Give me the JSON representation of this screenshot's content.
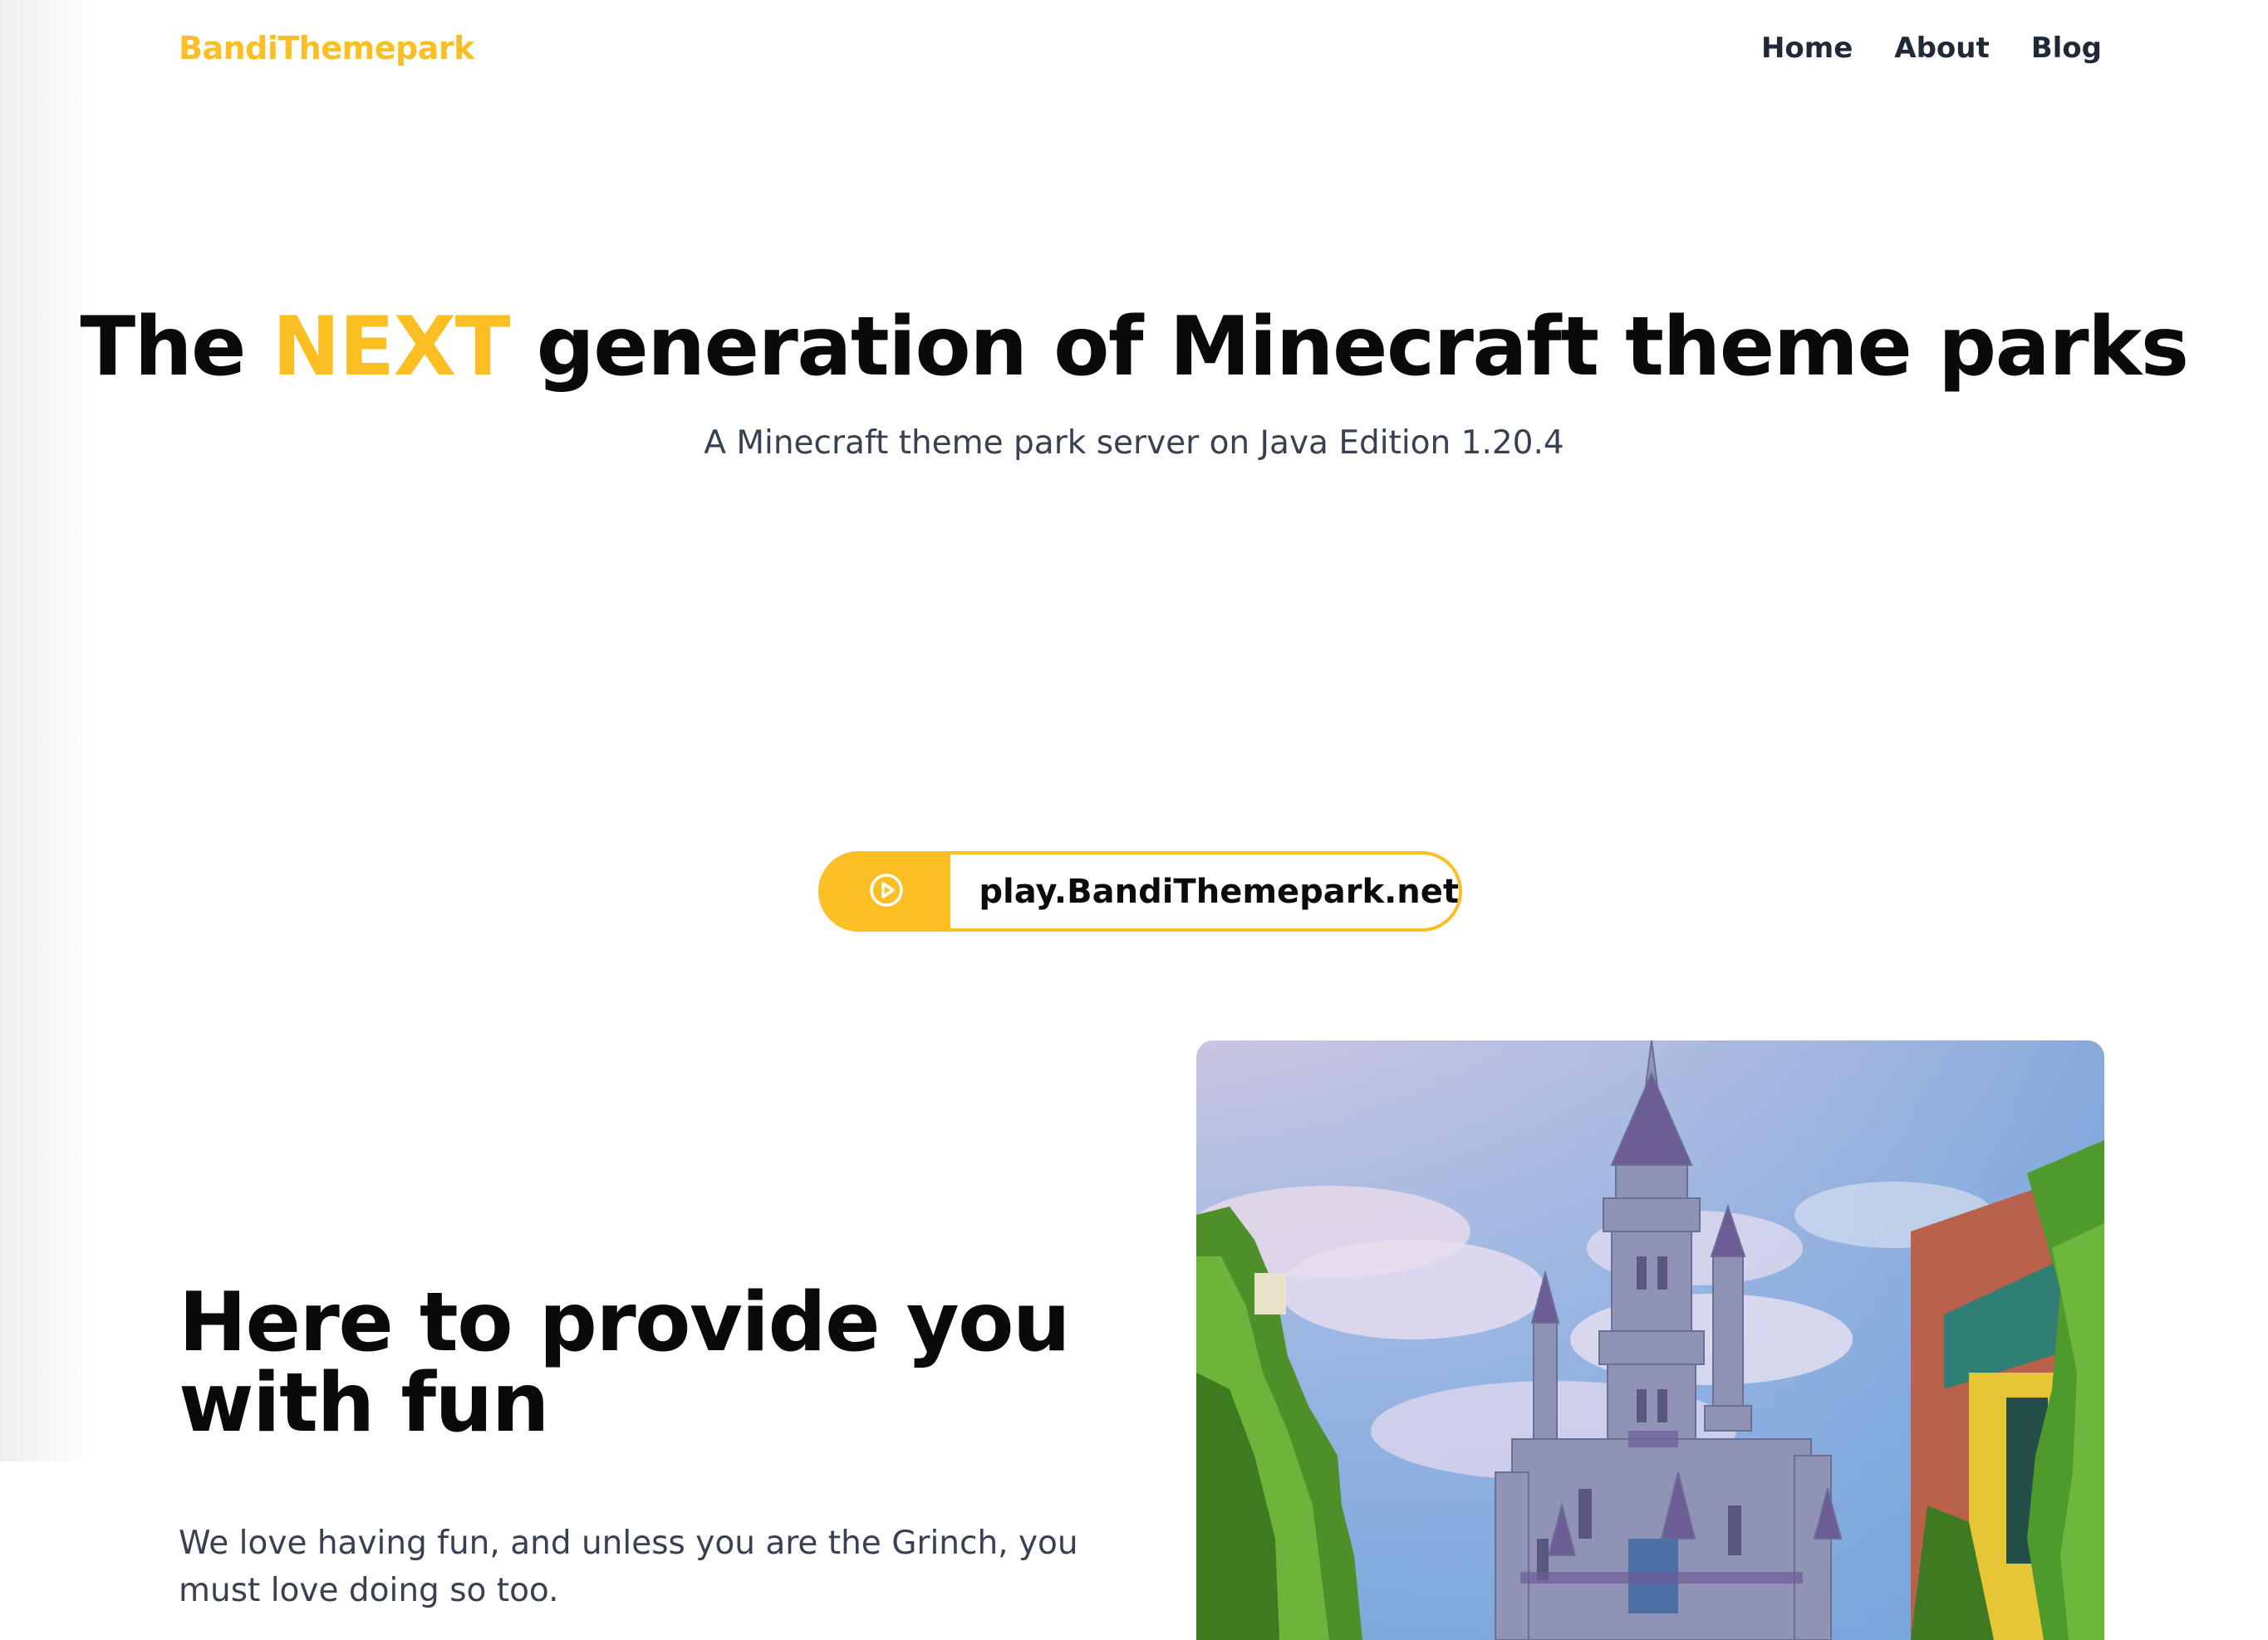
{
  "brand": "BandiThemepark",
  "nav": {
    "items": [
      "Home",
      "About",
      "Blog"
    ]
  },
  "hero": {
    "title_before": "The ",
    "title_accent": "NEXT",
    "title_after": " generation of Minecraft theme parks",
    "subtitle": "A Minecraft theme park server on Java Edition 1.20.4"
  },
  "server_ip": {
    "icon": "play-circle-icon",
    "address": "play.BandiThemepark.net"
  },
  "feature": {
    "title": "Here to provide you with fun",
    "text": "We love having fun, and unless you are the Grinch, you must love doing so too."
  },
  "colors": {
    "accent": "#fbbf24",
    "heading": "#0a0a0a",
    "body_text": "#374151",
    "nav_text": "#1f2937"
  }
}
